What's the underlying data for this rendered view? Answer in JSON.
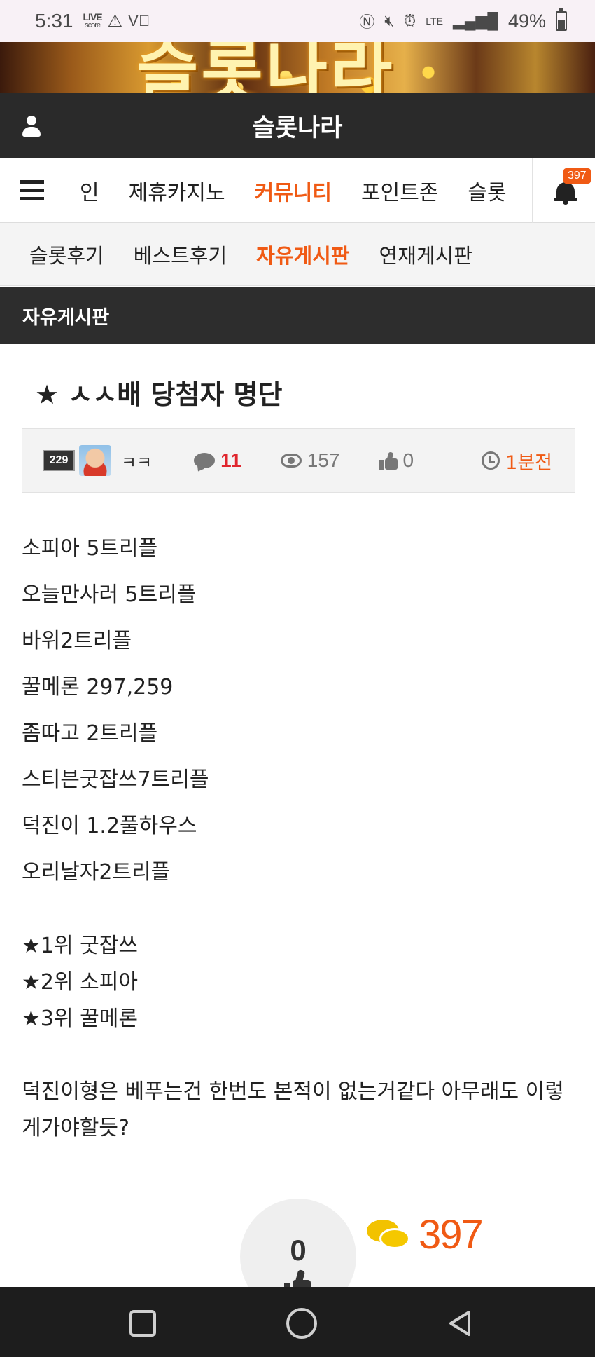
{
  "status_bar": {
    "time": "5:31",
    "live_label": "LIVE",
    "score_label": "score",
    "battery": "49%",
    "battery_level": 0.49,
    "network": "LTE"
  },
  "banner": {
    "logo_text": "슬롯나라"
  },
  "header": {
    "title": "슬롯나라"
  },
  "main_nav": {
    "items": [
      {
        "label": "인"
      },
      {
        "label": "제휴카지노"
      },
      {
        "label": "커뮤니티",
        "active": true
      },
      {
        "label": "포인트존"
      },
      {
        "label": "슬롯"
      }
    ],
    "notification_count": "397"
  },
  "sub_nav": {
    "items": [
      {
        "label": "슬롯후기"
      },
      {
        "label": "베스트후기"
      },
      {
        "label": "자유게시판",
        "active": true
      },
      {
        "label": "연재게시판"
      }
    ]
  },
  "board": {
    "title": "자유게시판"
  },
  "post": {
    "title": "★ ㅅㅅ배 당첨자 명단",
    "level_badge": "229",
    "author": "ㅋㅋ",
    "comment_count": "11",
    "view_count": "157",
    "like_count": "0",
    "time_ago": "1분전",
    "lines": [
      "소피아 5트리플",
      "오늘만사러 5트리플",
      "바위2트리플",
      "꿀메론 297,259",
      "좀따고 2트리플",
      "스티븐굿잡쓰7트리플",
      "덕진이 1.2풀하우스",
      "오리날자2트리플"
    ],
    "ranks": [
      "★1위 굿잡쓰",
      "★2위 소피아",
      "★3위 꿀메론"
    ],
    "closing": "덕진이형은 베푸는건 한번도 본적이 없는거같다 아무래도 이렇게가야할듯?",
    "recommend_count": "0",
    "total_comments": "397"
  },
  "colors": {
    "accent": "#f05a14",
    "comment_red": "#e0262e",
    "header_dark": "#2a2a2a",
    "bubble_yellow": "#f2c200"
  }
}
